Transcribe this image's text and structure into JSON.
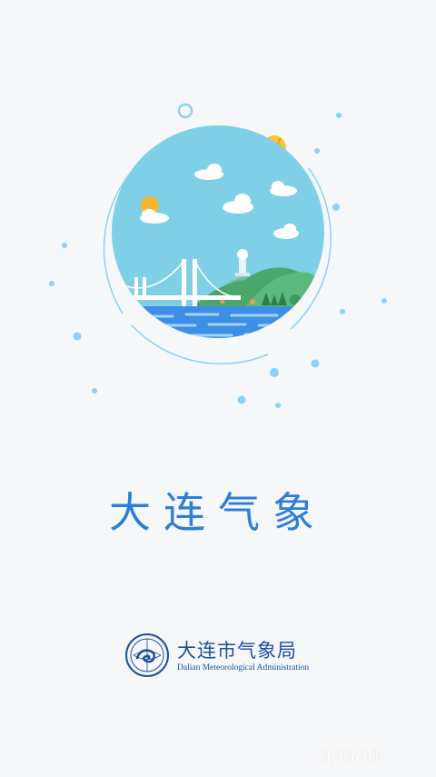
{
  "app_title": "大连气象",
  "organization": {
    "name_cn": "大连市气象局",
    "name_en": "Dalian Meteorological Administration"
  },
  "watermark": "ddddd",
  "colors": {
    "background": "#f6f7f9",
    "title": "#2d7fd6",
    "org_text": "#1f4e9c",
    "sky": "#7fd0e6",
    "sea": "#3d8ee6",
    "hill": "#4aa66b",
    "accent_dot": "#8fd0f4"
  },
  "icons": {
    "emblem": "dalian-meteorological-emblem",
    "illustration": "dalian-coast-illustration"
  }
}
